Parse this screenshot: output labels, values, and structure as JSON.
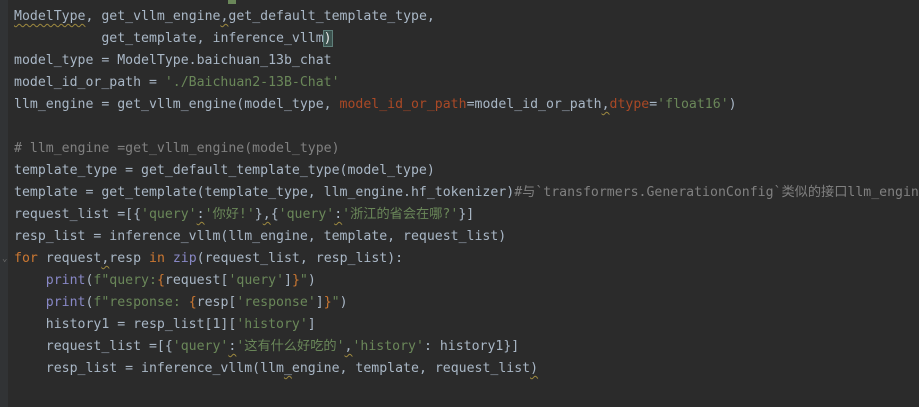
{
  "editor": {
    "lines": [
      {
        "tokens": [
          {
            "t": "ModelType",
            "c": "t-default",
            "wavy": true
          },
          {
            "t": ", ",
            "c": "t-default"
          },
          {
            "t": "get_vllm_engine",
            "c": "t-default"
          },
          {
            "t": ",",
            "c": "t-default",
            "wavy": true
          },
          {
            "t": "get_default_template_type",
            "c": "t-default"
          },
          {
            "t": ",",
            "c": "t-default"
          }
        ]
      },
      {
        "tokens": [
          {
            "t": "           get_template",
            "c": "t-default"
          },
          {
            "t": ", ",
            "c": "t-default"
          },
          {
            "t": "inference_vllm",
            "c": "t-default"
          },
          {
            "t": ")",
            "c": "t-paren-hl"
          }
        ]
      },
      {
        "tokens": [
          {
            "t": "model_type = ModelType.baichuan_13b_chat",
            "c": "t-default"
          }
        ]
      },
      {
        "tokens": [
          {
            "t": "model_id_or_path = ",
            "c": "t-default"
          },
          {
            "t": "'./Baichuan2-13B-Chat'",
            "c": "t-str"
          }
        ]
      },
      {
        "tokens": [
          {
            "t": "llm_engine = get_vllm_engine(model_type, ",
            "c": "t-default"
          },
          {
            "t": "model_id_or_path",
            "c": "t-param"
          },
          {
            "t": "=model_id_or_path",
            "c": "t-default"
          },
          {
            "t": ",",
            "c": "t-default",
            "wavy": true
          },
          {
            "t": "dtype",
            "c": "t-param"
          },
          {
            "t": "=",
            "c": "t-default"
          },
          {
            "t": "'float16'",
            "c": "t-str"
          },
          {
            "t": ")",
            "c": "t-default"
          }
        ]
      },
      {
        "tokens": [
          {
            "t": "",
            "c": "t-default"
          }
        ]
      },
      {
        "tokens": [
          {
            "t": "# llm_engine =get_vllm_engine(model_type)",
            "c": "t-comment"
          }
        ]
      },
      {
        "tokens": [
          {
            "t": "template_type = get_default_template_type(model_type)",
            "c": "t-default"
          }
        ]
      },
      {
        "tokens": [
          {
            "t": "template = get_template(template_type, llm_engine.hf_tokenizer)",
            "c": "t-default"
          },
          {
            "t": "#与`transformers.GenerationConfig`类似的接口llm_engin",
            "c": "t-comment"
          }
        ]
      },
      {
        "tokens": [
          {
            "t": "request_list =[{",
            "c": "t-default"
          },
          {
            "t": "'query'",
            "c": "t-str"
          },
          {
            "t": ":",
            "c": "t-default",
            "wavy": true
          },
          {
            "t": "'你好!'",
            "c": "t-str"
          },
          {
            "t": "}",
            "c": "t-default"
          },
          {
            "t": ",",
            "c": "t-default",
            "wavy": true
          },
          {
            "t": "{",
            "c": "t-default"
          },
          {
            "t": "'query'",
            "c": "t-str"
          },
          {
            "t": ":",
            "c": "t-default",
            "wavy": true
          },
          {
            "t": "'浙江的省会在哪?'",
            "c": "t-str"
          },
          {
            "t": "}]",
            "c": "t-default"
          }
        ]
      },
      {
        "tokens": [
          {
            "t": "resp_list = inference_vllm(llm_engine, template, request_list)",
            "c": "t-default"
          }
        ]
      },
      {
        "fold": true,
        "tokens": [
          {
            "t": "for ",
            "c": "t-kw"
          },
          {
            "t": "request",
            "c": "t-default"
          },
          {
            "t": ",",
            "c": "t-default",
            "wavy": true
          },
          {
            "t": "resp ",
            "c": "t-default"
          },
          {
            "t": "in ",
            "c": "t-kw"
          },
          {
            "t": "zip",
            "c": "t-builtin"
          },
          {
            "t": "(request_list, resp_list):",
            "c": "t-default"
          }
        ]
      },
      {
        "tokens": [
          {
            "t": "    ",
            "c": "t-default"
          },
          {
            "t": "print",
            "c": "t-builtin"
          },
          {
            "t": "(",
            "c": "t-default"
          },
          {
            "t": "f\"query:",
            "c": "t-fstr"
          },
          {
            "t": "{",
            "c": "t-kw"
          },
          {
            "t": "request[",
            "c": "t-default"
          },
          {
            "t": "'query'",
            "c": "t-str"
          },
          {
            "t": "]",
            "c": "t-default"
          },
          {
            "t": "}",
            "c": "t-kw"
          },
          {
            "t": "\"",
            "c": "t-fstr"
          },
          {
            "t": ")",
            "c": "t-default"
          }
        ]
      },
      {
        "tokens": [
          {
            "t": "    ",
            "c": "t-default"
          },
          {
            "t": "print",
            "c": "t-builtin"
          },
          {
            "t": "(",
            "c": "t-default"
          },
          {
            "t": "f\"response: ",
            "c": "t-fstr"
          },
          {
            "t": "{",
            "c": "t-kw"
          },
          {
            "t": "resp[",
            "c": "t-default"
          },
          {
            "t": "'response'",
            "c": "t-str"
          },
          {
            "t": "]",
            "c": "t-default"
          },
          {
            "t": "}",
            "c": "t-kw"
          },
          {
            "t": "\"",
            "c": "t-fstr"
          },
          {
            "t": ")",
            "c": "t-default"
          }
        ]
      },
      {
        "tokens": [
          {
            "t": "    history1 = resp_list[1][",
            "c": "t-default"
          },
          {
            "t": "'history'",
            "c": "t-str"
          },
          {
            "t": "]",
            "c": "t-default"
          }
        ]
      },
      {
        "tokens": [
          {
            "t": "    request_list =[{",
            "c": "t-default"
          },
          {
            "t": "'query'",
            "c": "t-str"
          },
          {
            "t": ":",
            "c": "t-default",
            "wavy": true
          },
          {
            "t": "'这有什么好吃的'",
            "c": "t-str"
          },
          {
            "t": ",",
            "c": "t-default",
            "wavy": true
          },
          {
            "t": "'history'",
            "c": "t-str"
          },
          {
            "t": ": history1}]",
            "c": "t-default"
          }
        ]
      },
      {
        "tokens": [
          {
            "t": "    resp_list = inference_vllm(llm",
            "c": "t-default"
          },
          {
            "t": "_",
            "c": "t-default",
            "wavy": true
          },
          {
            "t": "engine, template, request_list",
            "c": "t-default"
          },
          {
            "t": ")",
            "c": "t-default",
            "wavy": true
          }
        ]
      }
    ]
  },
  "icons": {
    "fold": "fold-arrow-icon"
  },
  "colors": {
    "background": "#2b2b2b",
    "default": "#a9b7c6",
    "keyword": "#cc7832",
    "string": "#6a8759",
    "param": "#aa4926",
    "builtin": "#8888c6",
    "comment": "#808080"
  }
}
